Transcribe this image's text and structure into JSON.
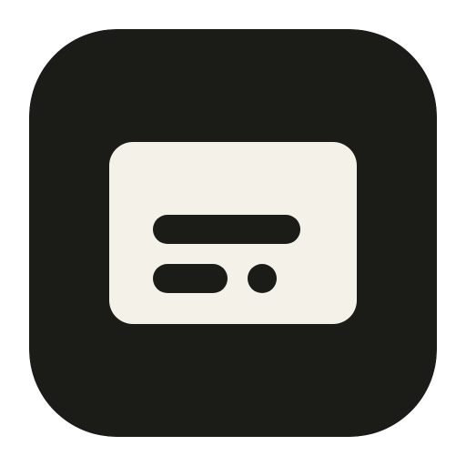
{
  "app_icon": {
    "icon_name": "caption-subtitles-icon",
    "colors": {
      "tile_background": "#1b1b17",
      "card": "#f4f1e8",
      "glyph": "#1b1b17"
    }
  }
}
